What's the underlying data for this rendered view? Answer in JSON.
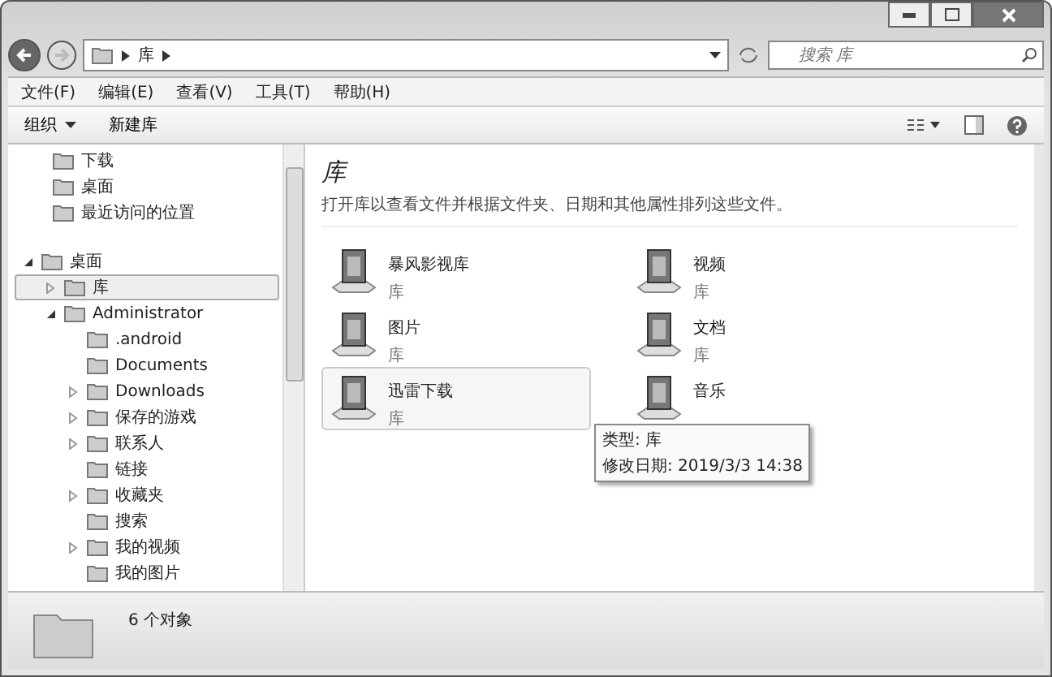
{
  "address": {
    "path": [
      "库"
    ],
    "search_placeholder": "搜索 库"
  },
  "menu": [
    "文件(F)",
    "编辑(E)",
    "查看(V)",
    "工具(T)",
    "帮助(H)"
  ],
  "toolbar": [
    {
      "label": "组织",
      "dropdown": true
    },
    {
      "label": "新建库",
      "dropdown": false
    }
  ],
  "sidebar": {
    "favorites": [
      {
        "label": "下载"
      },
      {
        "label": "桌面"
      },
      {
        "label": "最近访问的位置"
      }
    ],
    "tree": [
      {
        "label": "桌面",
        "expanded": true,
        "selected": false,
        "children": [
          {
            "label": "库",
            "expanded": false,
            "selected": true
          },
          {
            "label": "Administrator",
            "expanded": true,
            "selected": false,
            "children": [
              {
                "label": ".android",
                "selected": false
              },
              {
                "label": "Documents",
                "selected": false
              },
              {
                "label": "Downloads",
                "expanded": false,
                "selected": false
              },
              {
                "label": "保存的游戏",
                "expanded": false,
                "selected": false
              },
              {
                "label": "联系人",
                "expanded": false,
                "selected": false
              },
              {
                "label": "链接",
                "selected": false
              },
              {
                "label": "收藏夹",
                "expanded": false,
                "selected": false
              },
              {
                "label": "搜索",
                "selected": false
              },
              {
                "label": "我的视频",
                "expanded": false,
                "selected": false
              },
              {
                "label": "我的图片",
                "selected": false
              }
            ]
          }
        ]
      }
    ]
  },
  "content": {
    "title": "库",
    "description": "打开库以查看文件并根据文件夹、日期和其他属性排列这些文件。",
    "items": [
      {
        "name": "暴风影视库",
        "subtitle": "库",
        "hovered": false
      },
      {
        "name": "视频",
        "subtitle": "库",
        "hovered": false
      },
      {
        "name": "图片",
        "subtitle": "库",
        "hovered": false
      },
      {
        "name": "文档",
        "subtitle": "库",
        "hovered": false
      },
      {
        "name": "迅雷下载",
        "subtitle": "库",
        "hovered": true
      },
      {
        "name": "音乐",
        "hovered": false
      }
    ],
    "tooltip": [
      "类型: 库",
      "修改日期: 2019/3/3 14:38"
    ]
  },
  "status": {
    "count": "6 个对象"
  }
}
